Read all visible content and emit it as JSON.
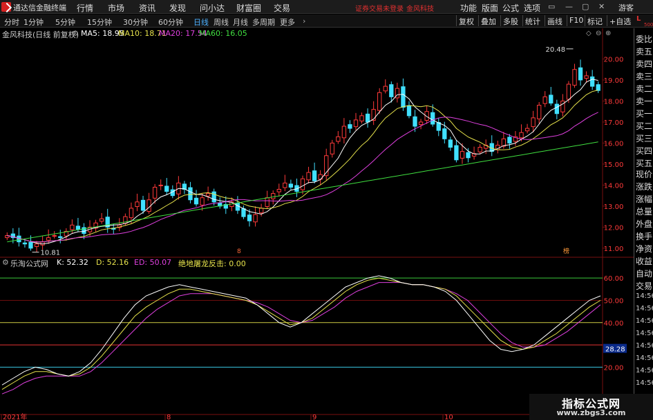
{
  "menubar": {
    "app_title": "通达信金融终端",
    "items": [
      "行情",
      "市场",
      "资讯",
      "发现",
      "问小达",
      "财富圈",
      "交易"
    ],
    "status_msg": "证券交易未登录",
    "stock_title": "金风科技",
    "right_items": [
      "功能",
      "版面",
      "公式",
      "选项"
    ],
    "guest": "游客"
  },
  "toolbar": {
    "periods": [
      "分时",
      "1分钟",
      "5分钟",
      "15分钟",
      "30分钟",
      "60分钟",
      "日线",
      "周线",
      "月线",
      "多周期",
      "更多"
    ],
    "active_period": "日线",
    "right_buttons": [
      "复权",
      "叠加",
      "多股",
      "统计",
      "画线",
      "F10",
      "标记",
      "+自选",
      "返回"
    ]
  },
  "badge": {
    "label": "L",
    "sub": "500"
  },
  "sidebar": {
    "items": [
      "委比",
      "卖五",
      "卖四",
      "卖三",
      "卖二",
      "卖一",
      "买一",
      "买二",
      "买三",
      "买四",
      "买五",
      "现价",
      "涨跌",
      "涨幅",
      "总量",
      "外盘",
      "换手",
      "净资",
      "收益",
      "自动",
      "交易",
      "14:56",
      "14:56",
      "14:56",
      "14:56",
      "14:56",
      "14:56",
      "14:56",
      "14:56"
    ]
  },
  "main_legend": {
    "name": "金风科技(日线 前复权)",
    "ma": [
      {
        "label": "MA5: 18.95",
        "color": "#ffffff"
      },
      {
        "label": "MA10: 18.71",
        "color": "#e8e44c"
      },
      {
        "label": "MA20: 17.54",
        "color": "#e040e0"
      },
      {
        "label": "MA60: 16.05",
        "color": "#40e040"
      }
    ]
  },
  "sub_legend": {
    "name": "乐淘公式网",
    "items": [
      {
        "label": "K: 52.32",
        "color": "#ffffff"
      },
      {
        "label": "D: 52.16",
        "color": "#e8e44c"
      },
      {
        "label": "ED: 50.07",
        "color": "#e040e0"
      },
      {
        "label": "绝地屠龙反击: 0.00",
        "color": "#e8e44c"
      }
    ]
  },
  "colors": {
    "up": "#ff3a3a",
    "down": "#40e0ff",
    "ma5": "#ffffff",
    "ma10": "#e8e44c",
    "ma20": "#e040e0",
    "ma60": "#40e040",
    "grid": "#7a1010"
  },
  "chart_data": {
    "type": "candlestick",
    "y_ticks": [
      "20.00",
      "19.00",
      "18.00",
      "17.00",
      "16.00",
      "15.00",
      "14.00",
      "13.00",
      "12.00",
      "11.00"
    ],
    "ylim": [
      10.7,
      21.0
    ],
    "annotations": {
      "high": "20.48",
      "low": "10.81"
    },
    "x_labels": [
      "2021年",
      "8",
      "9",
      "10"
    ],
    "event_marks": [
      "8",
      "榜"
    ],
    "closes": [
      11.6,
      11.5,
      11.3,
      11.2,
      11.0,
      11.2,
      11.3,
      11.5,
      11.6,
      11.5,
      11.8,
      12.1,
      11.9,
      11.7,
      12.0,
      12.2,
      12.4,
      12.0,
      11.9,
      12.1,
      12.5,
      12.9,
      13.2,
      12.8,
      13.3,
      13.9,
      14.0,
      13.7,
      13.5,
      14.1,
      13.8,
      13.3,
      13.1,
      13.4,
      13.6,
      13.2,
      13.0,
      12.9,
      13.2,
      12.8,
      12.5,
      12.3,
      12.6,
      12.9,
      13.4,
      13.6,
      13.8,
      14.1,
      13.9,
      13.7,
      14.3,
      14.6,
      14.2,
      14.5,
      15.4,
      16.0,
      16.3,
      16.8,
      16.7,
      17.1,
      17.3,
      17.0,
      17.6,
      18.4,
      18.7,
      18.2,
      18.6,
      17.7,
      17.3,
      16.8,
      17.0,
      17.5,
      16.9,
      16.6,
      16.2,
      15.8,
      15.2,
      15.6,
      15.3,
      15.5,
      15.8,
      15.9,
      15.6,
      15.9,
      16.2,
      16.0,
      16.3,
      16.5,
      16.7,
      17.2,
      17.8,
      18.2,
      17.9,
      17.4,
      18.0,
      18.8,
      19.5,
      19.0,
      19.2,
      18.7,
      18.5
    ],
    "kdj": {
      "k_line": [
        12,
        15,
        18,
        20,
        19,
        17,
        16,
        18,
        22,
        28,
        35,
        42,
        48,
        52,
        54,
        56,
        57,
        56,
        55,
        54,
        53,
        52,
        51,
        48,
        44,
        40,
        38,
        40,
        44,
        48,
        52,
        56,
        58,
        60,
        61,
        60,
        58,
        57,
        57,
        56,
        54,
        50,
        44,
        38,
        32,
        28,
        27,
        28,
        30,
        34,
        38,
        42,
        46,
        50,
        52
      ],
      "d_line": [
        10,
        13,
        16,
        18,
        18,
        17,
        16,
        17,
        20,
        25,
        31,
        37,
        43,
        47,
        50,
        53,
        55,
        55,
        54,
        53,
        52,
        51,
        50,
        48,
        45,
        42,
        39,
        40,
        42,
        46,
        50,
        54,
        57,
        59,
        60,
        59,
        58,
        57,
        57,
        56,
        55,
        52,
        47,
        42,
        37,
        32,
        29,
        28,
        29,
        32,
        35,
        39,
        43,
        47,
        50
      ],
      "ed_line": [
        8,
        10,
        13,
        15,
        16,
        16,
        16,
        16,
        18,
        22,
        27,
        32,
        37,
        42,
        46,
        49,
        52,
        53,
        53,
        53,
        52,
        51,
        50,
        49,
        47,
        44,
        41,
        40,
        41,
        44,
        47,
        51,
        54,
        56,
        58,
        58,
        58,
        57,
        57,
        56,
        55,
        53,
        50,
        45,
        40,
        35,
        31,
        29,
        29,
        30,
        33,
        36,
        40,
        44,
        48
      ]
    },
    "sub_y_ticks": [
      "60.00",
      "50.00",
      "40.00",
      "20.00"
    ],
    "sub_ylim": [
      0,
      65
    ],
    "sub_value_tag": "28.28"
  }
}
